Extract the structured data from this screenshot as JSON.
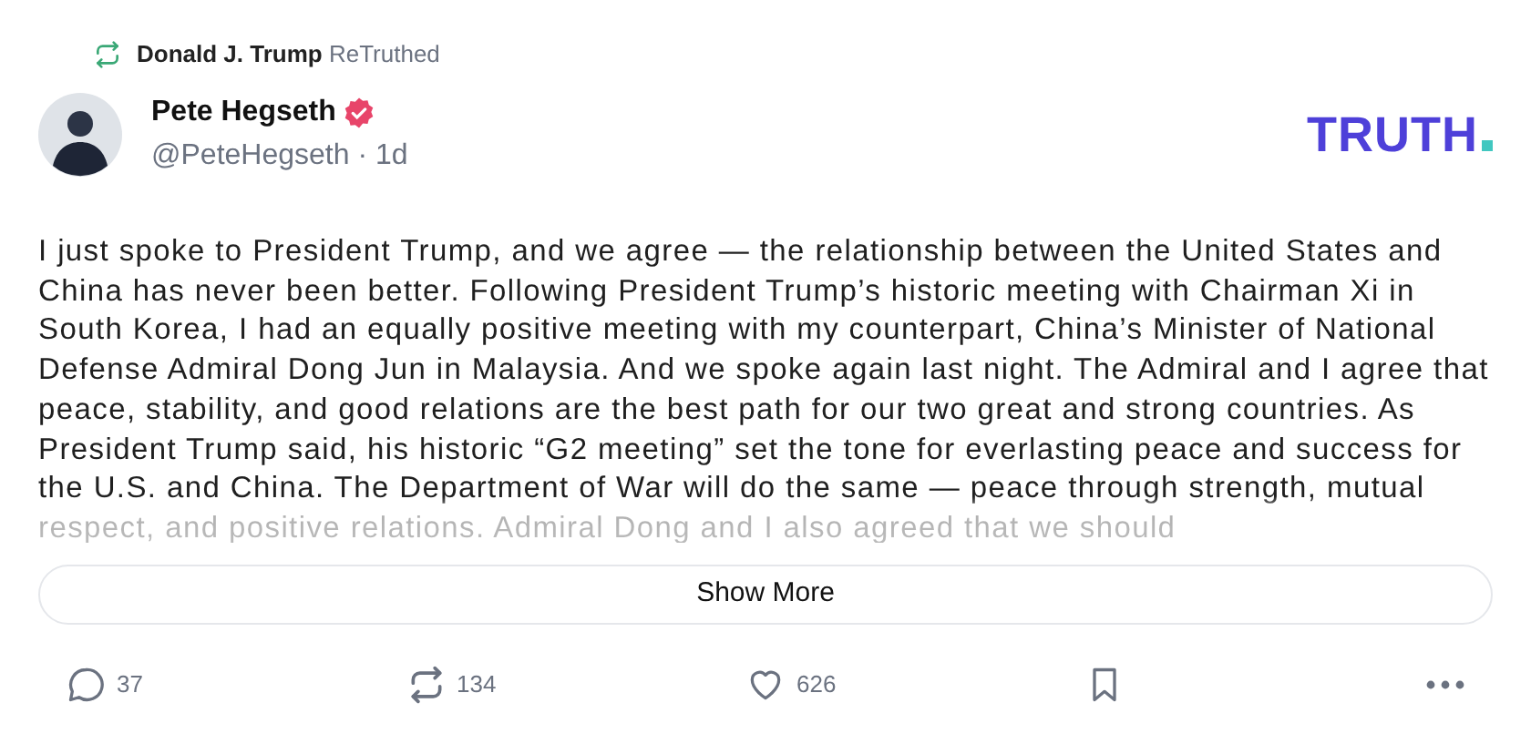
{
  "retruth": {
    "name": "Donald J. Trump",
    "label": "ReTruthed"
  },
  "author": {
    "name": "Pete Hegseth",
    "verified": true,
    "handle": "@PeteHegseth",
    "separator": "·",
    "time": "1d"
  },
  "logo": {
    "text": "TRUTH"
  },
  "post": {
    "text": "I just spoke to President Trump, and we agree — the relationship between the United States and China has never been better. Following President Trump’s historic meeting with Chairman Xi in South Korea, I had an equally positive meeting with my counterpart, China’s Minister of National Defense Admiral Dong Jun in Malaysia. And we spoke again last night. The Admiral and I agree that peace, stability, and good relations are the best path for our two great and strong countries. As President Trump said, his historic “G2 meeting” set the tone for everlasting peace and success for the U.S. and China. The Department of War will do the same — peace through strength, mutual respect, and positive relations. Admiral Dong and I also agreed that we should",
    "truncated": true
  },
  "show_more": "Show More",
  "actions": [
    {
      "kind": "reply",
      "count": "37"
    },
    {
      "kind": "retruth",
      "count": "134"
    },
    {
      "kind": "like",
      "count": "626"
    },
    {
      "kind": "bookmark"
    },
    {
      "kind": "more"
    }
  ]
}
